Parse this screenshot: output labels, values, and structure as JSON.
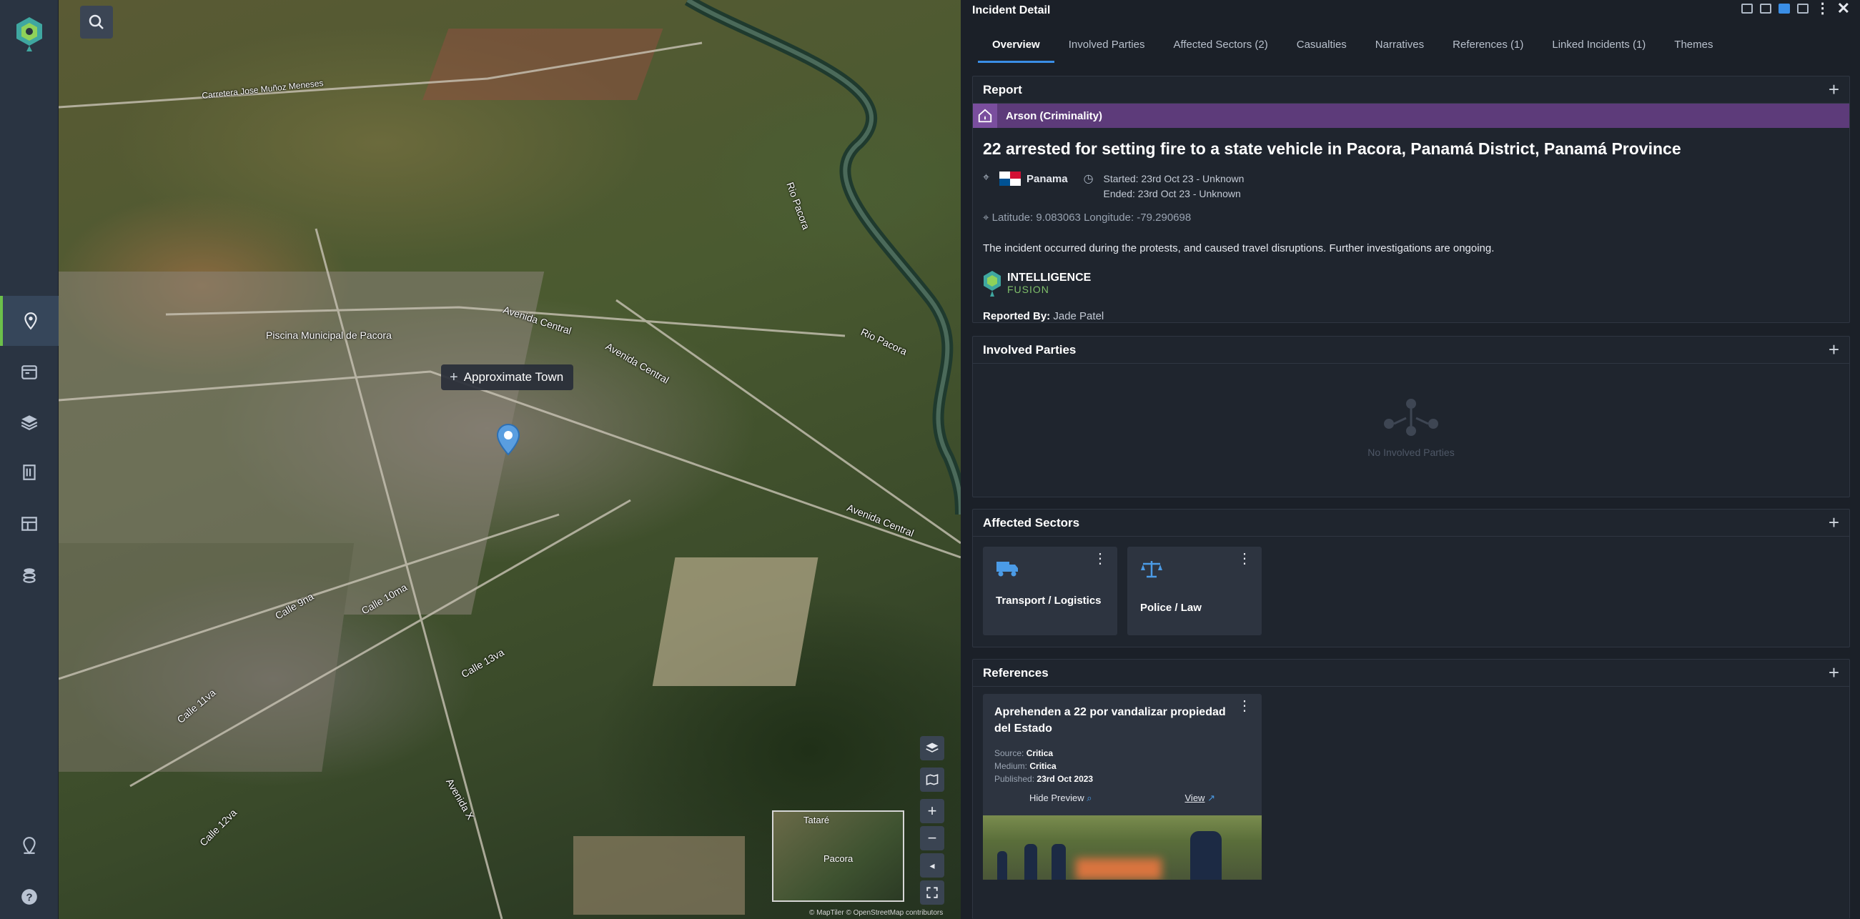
{
  "map": {
    "tooltip": "Approximate Town",
    "labels": {
      "piscina": "Piscina Municipal de Pacora",
      "av_central_1": "Avenida Central",
      "av_central_2": "Avenida Central",
      "av_central_3": "Avenida Central",
      "rio_pacora_1": "Rio Pacora",
      "rio_pacora_2": "Rio Pacora",
      "carretera": "Carretera Jose Muñoz Meneses",
      "calle_9": "Calle 9na",
      "calle_10": "Calle 10ma",
      "calle_11": "Calle 11va",
      "calle_13": "Calle 13va",
      "avenida_x": "Avenida X",
      "calle_12": "Calle 12va"
    },
    "minimap": {
      "label_top": "Tataré",
      "label_center": "Pacora"
    },
    "attribution": "© MapTiler © OpenStreetMap contributors",
    "controls": {
      "zoom_in": "+",
      "zoom_out": "−"
    }
  },
  "panel": {
    "title": "Incident Detail",
    "tabs": [
      "Overview",
      "Involved Parties",
      "Affected Sectors (2)",
      "Casualties",
      "Narratives",
      "References (1)",
      "Linked Incidents (1)",
      "Themes"
    ],
    "report": {
      "heading": "Report",
      "category": "Arson (Criminality)",
      "headline": "22 arrested for setting fire to a state vehicle in Pacora, Panamá District, Panamá Province",
      "country": "Panama",
      "started": "Started: 23rd Oct 23 - Unknown",
      "ended": "Ended: 23rd Oct 23 - Unknown",
      "latlon": "Latitude: 9.083063 Longitude: -79.290698",
      "description": "The incident occurred during the protests, and caused travel disruptions. Further investigations are ongoing.",
      "source_brand_1": "INTELLIGENCE",
      "source_brand_2": "FUSION",
      "reported_by_label": "Reported By:",
      "reported_by": "Jade Patel"
    },
    "involved": {
      "heading": "Involved Parties",
      "empty": "No Involved Parties"
    },
    "sectors": {
      "heading": "Affected Sectors",
      "items": [
        {
          "label": "Transport / Logistics",
          "icon": "truck-icon"
        },
        {
          "label": "Police / Law",
          "icon": "scales-icon"
        }
      ]
    },
    "references": {
      "heading": "References",
      "item": {
        "title": "Aprehenden a 22 por vandalizar propiedad del Estado",
        "source_label": "Source:",
        "source": "Critica",
        "medium_label": "Medium:",
        "medium": "Critica",
        "published_label": "Published:",
        "published": "23rd Oct 2023",
        "hide_preview": "Hide Preview",
        "view": "View"
      }
    }
  },
  "colors": {
    "accent": "#3a8ee6",
    "category": "#5d3b7a",
    "brand_green": "#6cc04a"
  }
}
